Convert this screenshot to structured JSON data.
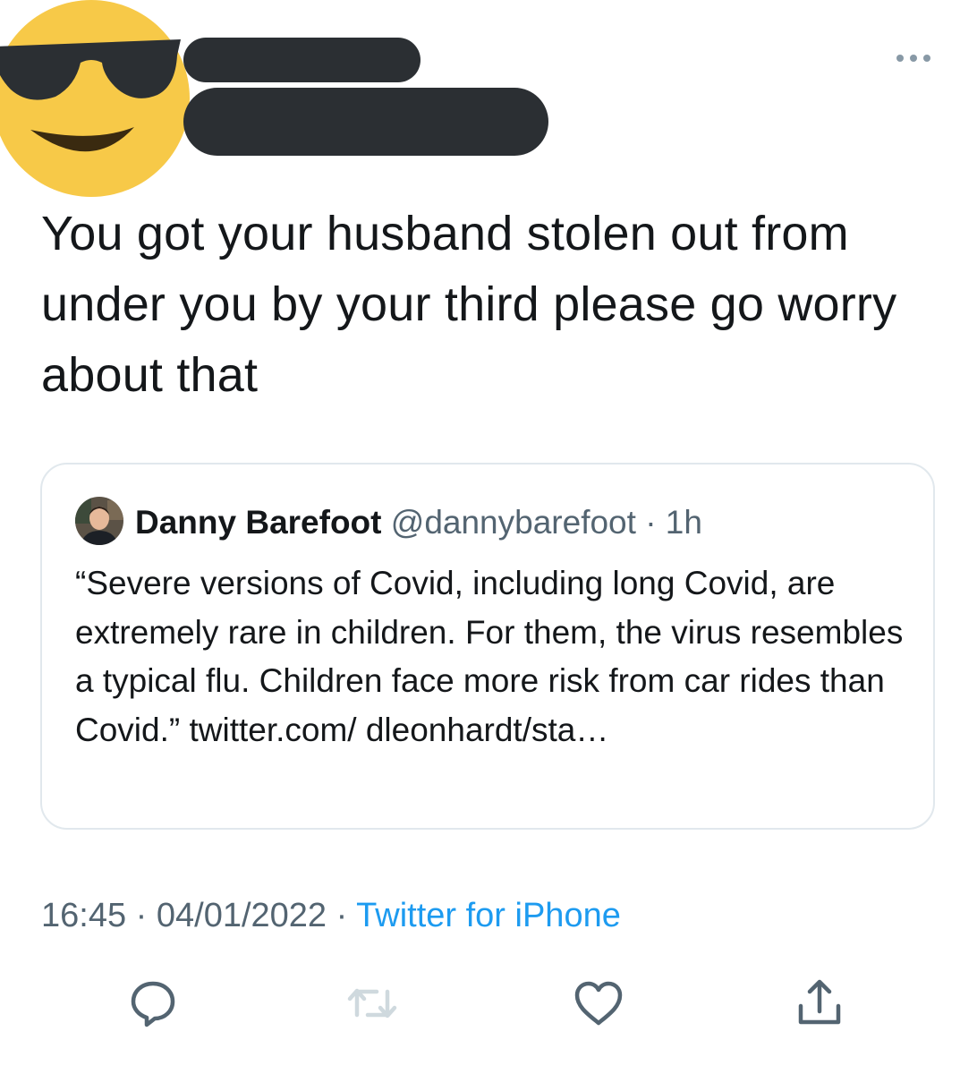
{
  "tweet": {
    "text": "You got your husband stolen out from under you by your third please go worry about that",
    "timestamp_time": "16:45",
    "separator": "·",
    "timestamp_date": "04/01/2022",
    "source": "Twitter for iPhone"
  },
  "quoted_tweet": {
    "author_name": "Danny Barefoot",
    "author_handle": "@dannybarefoot",
    "separator": "·",
    "time_ago": "1h",
    "text": "“Severe versions of Covid, including long Covid, are extremely rare in children. For them, the virus resembles a typical flu. Children face more risk from car rides than Covid.” twitter.com/ dleonhardt/sta…"
  },
  "icons": {
    "avatar": "sunglasses-emoji",
    "more": "more-horizontal-icon",
    "reply": "reply-icon",
    "retweet": "retweet-icon",
    "like": "heart-icon",
    "share": "share-icon"
  },
  "colors": {
    "link": "#1d9bf0",
    "secondary_text": "#536471",
    "redaction": "#2b2f33",
    "emoji_yellow": "#f7c948",
    "disabled_icon": "#cfd9de"
  }
}
